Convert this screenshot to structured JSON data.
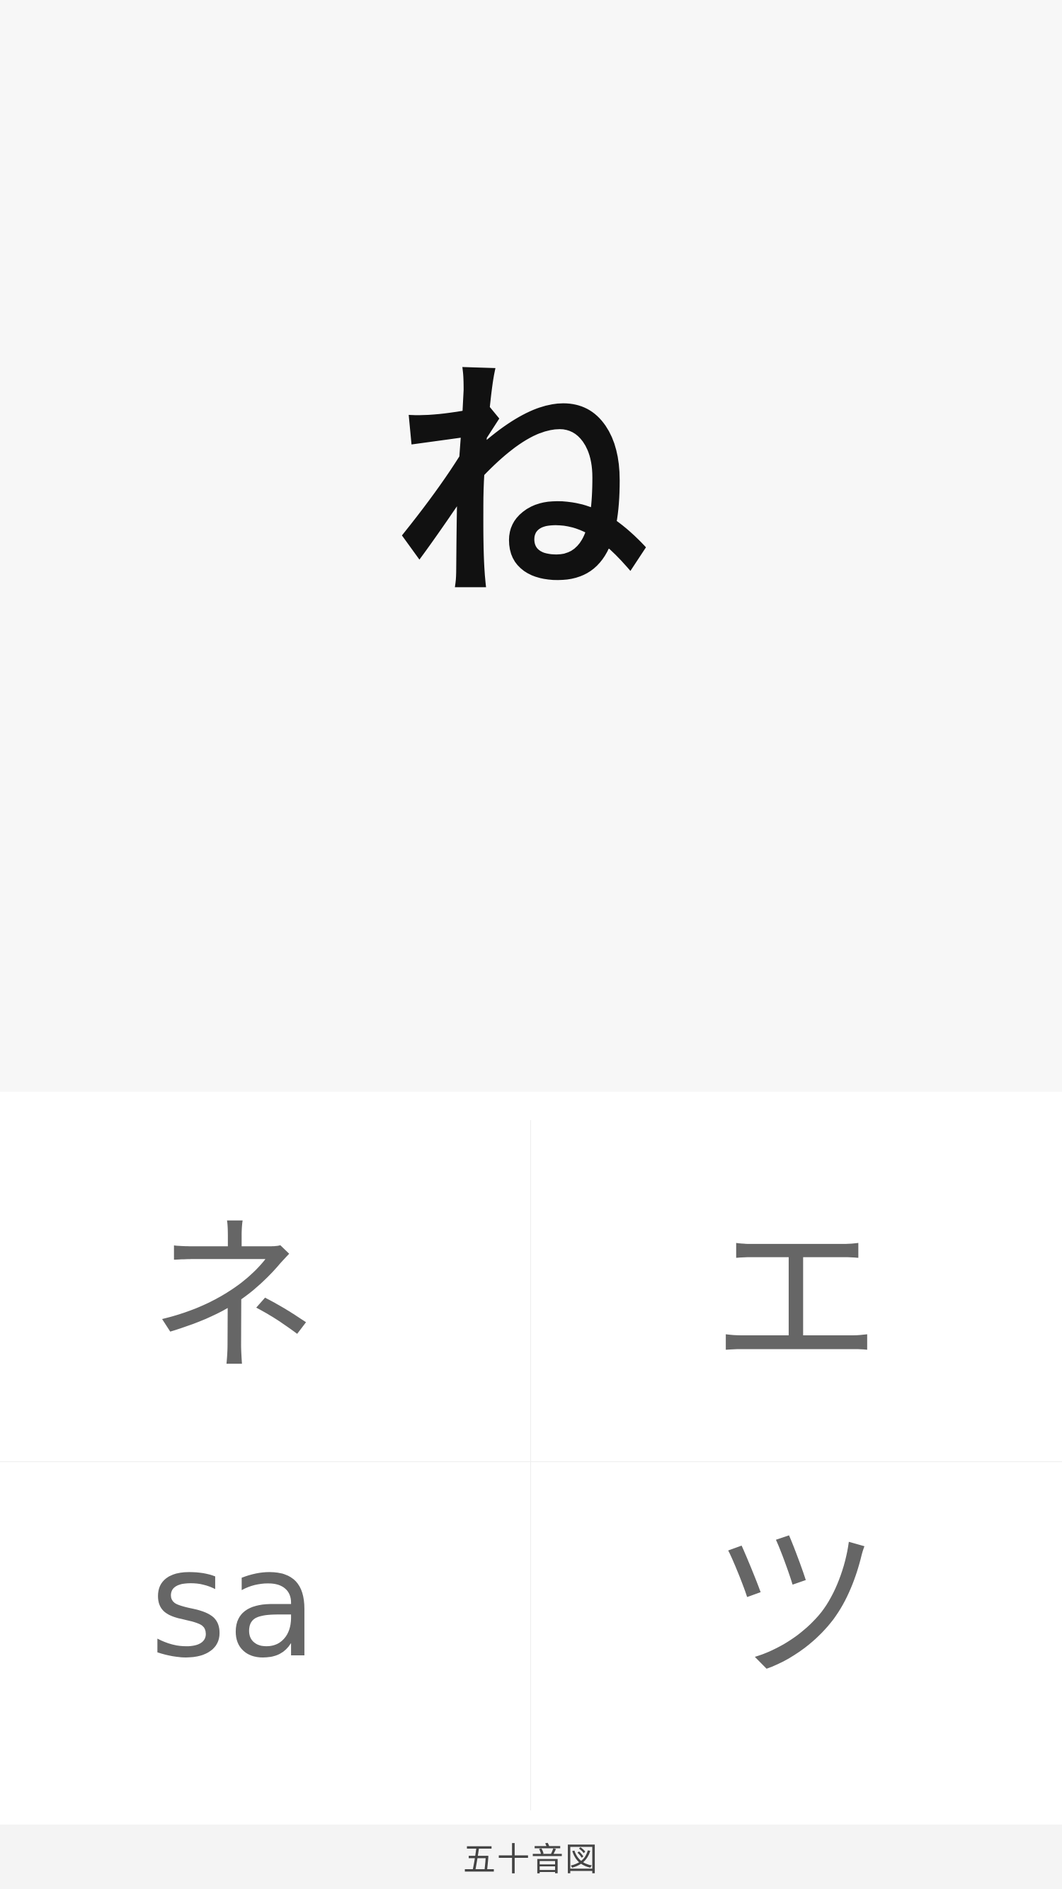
{
  "prompt": {
    "character": "ね"
  },
  "choices": [
    {
      "label": "ネ"
    },
    {
      "label": "エ"
    },
    {
      "label": "sa"
    },
    {
      "label": "ツ"
    }
  ],
  "footer": {
    "label": "五十音図"
  }
}
